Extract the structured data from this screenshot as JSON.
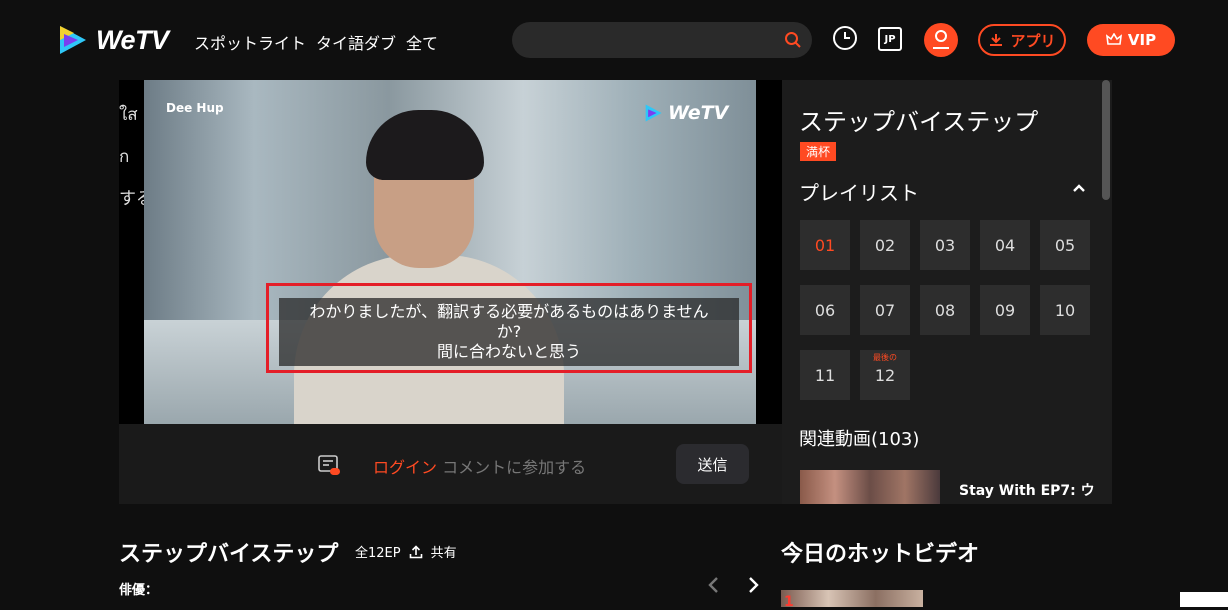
{
  "header": {
    "brand": "WeTV",
    "nav": [
      "スポットライト",
      "タイ語ダブ",
      "全て"
    ],
    "search_placeholder": "",
    "lang": "JP",
    "app_label": "アプリ",
    "vip_label": "VIP"
  },
  "player": {
    "side_text": [
      "ใส",
      "ก",
      "する"
    ],
    "watermark_left": "Dee Hup",
    "watermark_right": "WeTV",
    "subtitle_lines": [
      "わかりましたが、翻訳する必要があるものはありません",
      "か?",
      "間に合わないと思う"
    ]
  },
  "comment": {
    "login": "ログイン",
    "prompt": "コメントに参加する",
    "send": "送信"
  },
  "panel": {
    "title": "ステップバイステップ",
    "badge": "満杯",
    "playlist_label": "プレイリスト",
    "episodes": [
      "01",
      "02",
      "03",
      "04",
      "05",
      "06",
      "07",
      "08",
      "09",
      "10",
      "11",
      "12"
    ],
    "active_episode": "01",
    "last_episode_tag": "最後の",
    "related_title": "関連動画(103)",
    "related_item": "Stay With EP7: ウ"
  },
  "bottom": {
    "title": "ステップバイステップ",
    "episodes": "全12EP",
    "share": "共有",
    "cast_label": "俳優：",
    "hot_title": "今日のホットビデオ",
    "hot_rank": "1"
  },
  "colors": {
    "accent": "#ff4a22",
    "highlight_box": "#e41e28"
  }
}
